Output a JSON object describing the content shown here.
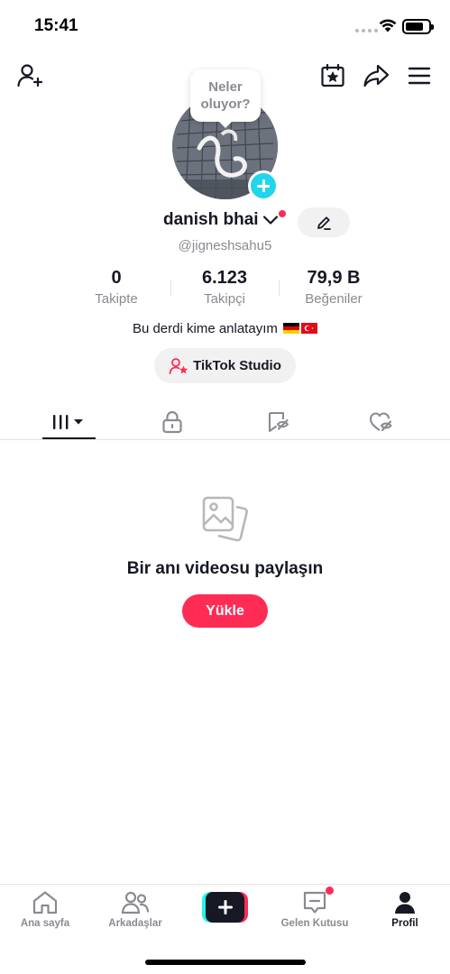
{
  "status_bar": {
    "time": "15:41"
  },
  "profile": {
    "bubble_text": "Neler oluyor?",
    "username": "danish bhai",
    "handle": "@jigneshsahu5",
    "bio": "Bu derdi kime anlatayım",
    "bio_flags": [
      "germany-flag",
      "turkey-flag"
    ],
    "studio_label": "TikTok Studio"
  },
  "stats": [
    {
      "value": "0",
      "label": "Takipte"
    },
    {
      "value": "6.123",
      "label": "Takipçi"
    },
    {
      "value": "79,9 B",
      "label": "Beğeniler"
    }
  ],
  "tabs": [
    {
      "icon": "grid-videos-icon",
      "active": true
    },
    {
      "icon": "lock-icon",
      "active": false
    },
    {
      "icon": "bookmark-hidden-icon",
      "active": false
    },
    {
      "icon": "heart-hidden-icon",
      "active": false
    }
  ],
  "empty_state": {
    "title": "Bir anı videosu paylaşın",
    "upload_label": "Yükle"
  },
  "bottom_nav": {
    "home": "Ana sayfa",
    "friends": "Arkadaşlar",
    "inbox": "Gelen Kutusu",
    "profile": "Profil"
  },
  "colors": {
    "accent": "#fe2c55",
    "cyan": "#20d5ec",
    "text": "#161823",
    "muted": "#8a8b91"
  }
}
